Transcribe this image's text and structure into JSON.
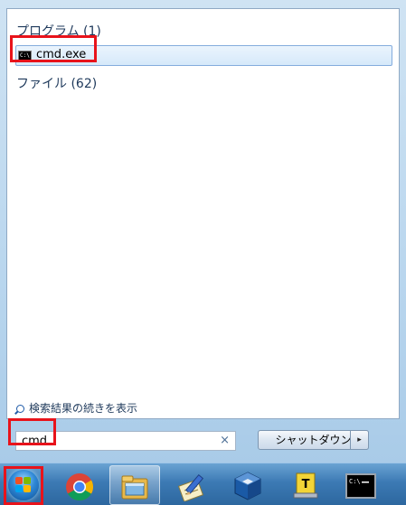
{
  "results": {
    "programs_header": "プログラム (1)",
    "program_item": "cmd.exe",
    "files_header": "ファイル (62)"
  },
  "more_results_link": "検索結果の続きを表示",
  "search": {
    "value": "cmd",
    "clear_glyph": "×"
  },
  "shutdown": {
    "label": "シャットダウン",
    "arrow_glyph": "▸"
  },
  "taskbar": {
    "items": [
      "start-orb",
      "chrome-icon",
      "file-explorer-icon",
      "notepad-pencil-icon",
      "virtualbox-icon",
      "typora-icon",
      "command-prompt-icon"
    ]
  },
  "colors": {
    "highlight": "#e8131b",
    "header_text": "#1e395b",
    "selected_row": "#d6e9fa"
  }
}
